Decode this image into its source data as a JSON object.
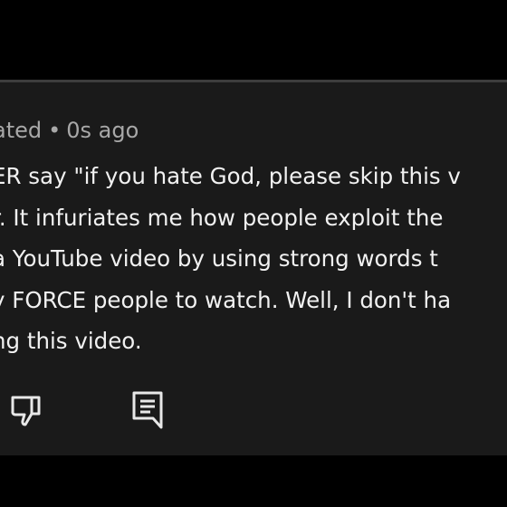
{
  "comment": {
    "author_fragment": "ated",
    "separator": "•",
    "timestamp": "0s ago",
    "lines": [
      "ER say \"if you hate God, please skip this v",
      "r. It infuriates me how people exploit the",
      "a YouTube video by using strong words t",
      "y FORCE people to watch. Well, I don't ha",
      "ng this video."
    ]
  },
  "actions": {
    "dislike_icon": "thumbs-down-outline",
    "reply_icon": "comment-outline"
  },
  "colors": {
    "page_background": "#000000",
    "panel_background": "#1a1a1a",
    "divider": "#3d3d3d",
    "meta_text": "#a8a8a8",
    "body_text": "#f1f1f1",
    "icon": "#e8e8e8"
  }
}
